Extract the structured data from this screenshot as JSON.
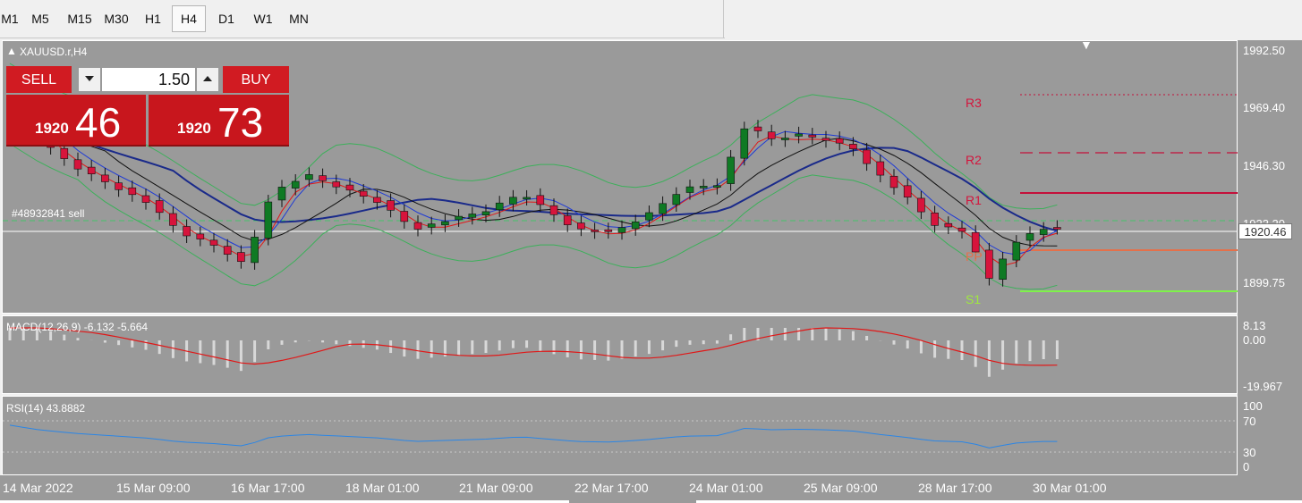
{
  "toolbar": {
    "timeframes": [
      "M1",
      "M5",
      "M15",
      "M30",
      "H1",
      "H4",
      "D1",
      "W1",
      "MN"
    ],
    "active": "H4"
  },
  "chart": {
    "title": "XAUUSD.r,H4",
    "order_label": "#48932841 sell",
    "pivots": {
      "r3": "R3",
      "r2": "R2",
      "r1": "R1",
      "pp": "PP",
      "s1": "S1"
    },
    "current_price": "1920.46",
    "price_axis": [
      "1992.50",
      "1969.40",
      "1946.30",
      "1923.20",
      "1899.75"
    ],
    "time_axis": [
      "14 Mar 2022",
      "15 Mar 09:00",
      "16 Mar 17:00",
      "18 Mar 01:00",
      "21 Mar 09:00",
      "22 Mar 17:00",
      "24 Mar 01:00",
      "25 Mar 09:00",
      "28 Mar 17:00",
      "30 Mar 01:00"
    ]
  },
  "trade_panel": {
    "sell_label": "SELL",
    "buy_label": "BUY",
    "lot": "1.50",
    "sell_small": "1920",
    "sell_big": "46",
    "buy_small": "1920",
    "buy_big": "73"
  },
  "macd": {
    "label": "MACD(12,26,9) -6.132 -5.664",
    "axis": [
      "8.13",
      "0.00",
      "-19.967"
    ]
  },
  "rsi": {
    "label": "RSI(14) 43.8882",
    "axis": [
      "100",
      "70",
      "30",
      "0"
    ]
  },
  "colors": {
    "background": "#9a9a9a",
    "bull": "#0f7a24",
    "bear": "#d7143c",
    "sell": "#d11b22",
    "ma_blue": "#1a2a8a",
    "r_lines": "#c4103a",
    "pp_line": "#e5704a",
    "s1_line": "#7ef24a",
    "rsi_line": "#2b86e6"
  }
}
